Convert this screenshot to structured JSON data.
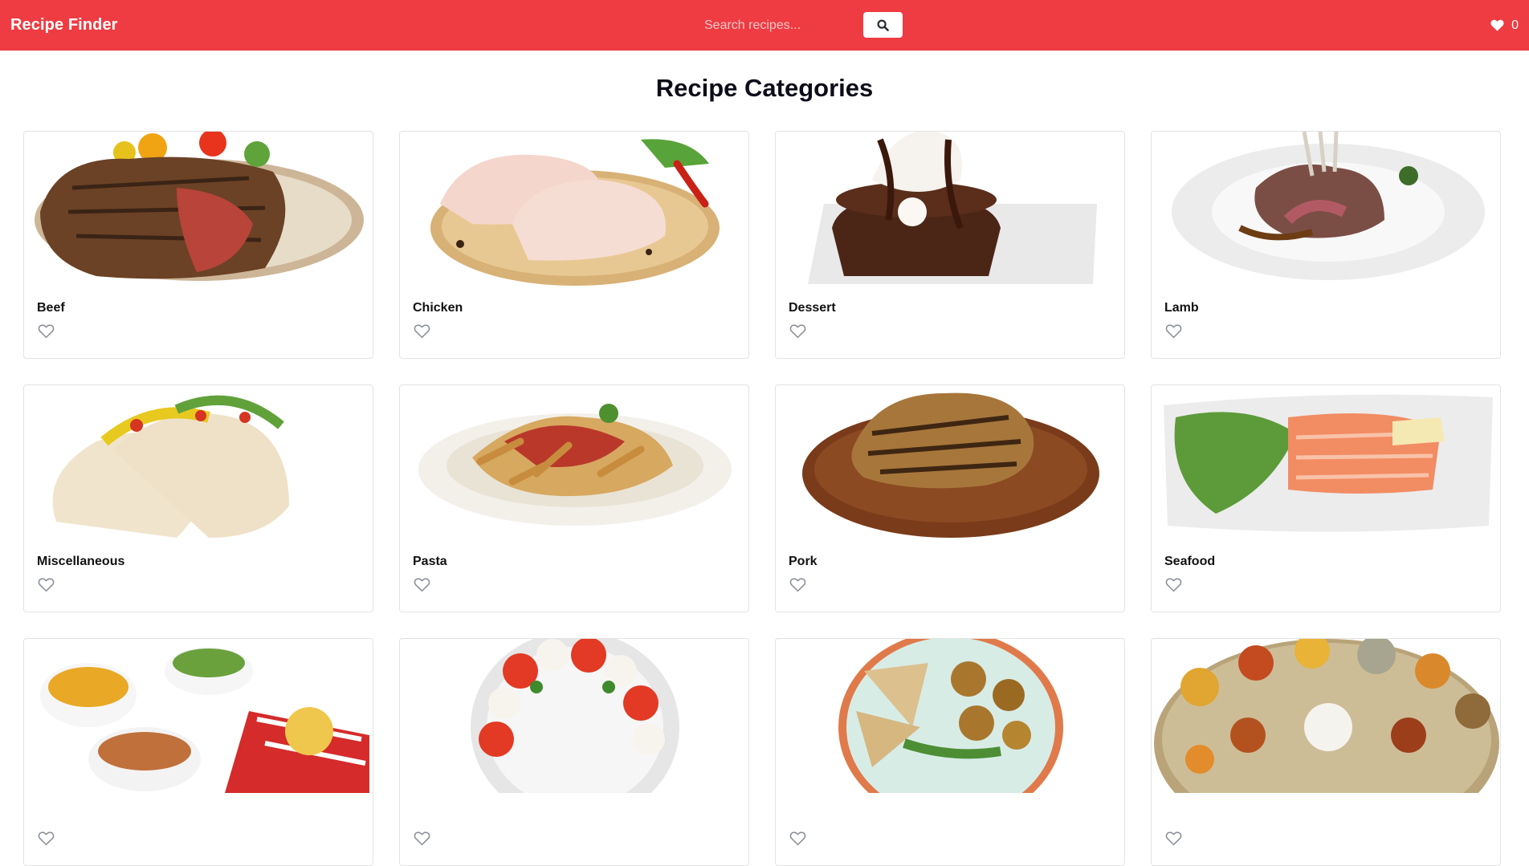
{
  "header": {
    "brand": "Recipe Finder",
    "search_placeholder": "Search recipes...",
    "search_icon": "search-icon",
    "favorites_icon": "heart-icon",
    "favorites_count": "0"
  },
  "main": {
    "title": "Recipe Categories",
    "categories": [
      {
        "name": "Beef",
        "slug": "beef"
      },
      {
        "name": "Chicken",
        "slug": "chicken"
      },
      {
        "name": "Dessert",
        "slug": "dessert"
      },
      {
        "name": "Lamb",
        "slug": "lamb"
      },
      {
        "name": "Miscellaneous",
        "slug": "miscellaneous"
      },
      {
        "name": "Pasta",
        "slug": "pasta"
      },
      {
        "name": "Pork",
        "slug": "pork"
      },
      {
        "name": "Seafood",
        "slug": "seafood"
      },
      {
        "name": "",
        "slug": "side"
      },
      {
        "name": "",
        "slug": "starter"
      },
      {
        "name": "",
        "slug": "vegan"
      },
      {
        "name": "",
        "slug": "vegetarian"
      }
    ]
  },
  "colors": {
    "navbar": "#ef3b42",
    "heart_outline": "#8a8f98"
  }
}
